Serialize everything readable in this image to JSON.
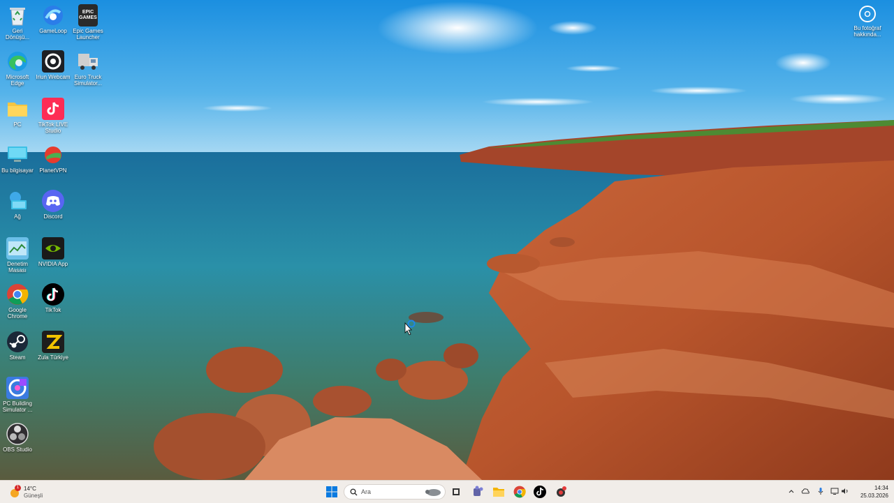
{
  "desktop": {
    "icons": [
      {
        "label": "Geri Dönüşü...",
        "icon": "recycle-bin-icon"
      },
      {
        "label": "GameLoop",
        "icon": "gameloop-icon"
      },
      {
        "label": "Epic Games Launcher",
        "icon": "epic-games-icon",
        "glyph_text": "EPIC GAMES"
      },
      {
        "label": "Microsoft Edge",
        "icon": "edge-icon"
      },
      {
        "label": "Iriun Webcam",
        "icon": "iriun-webcam-icon"
      },
      {
        "label": "Euro Truck Simulator...",
        "icon": "euro-truck-icon"
      },
      {
        "label": "PC",
        "icon": "folder-icon"
      },
      {
        "label": "TikTok LIVE Studio",
        "icon": "tiktok-live-icon"
      },
      {
        "label": "Bu bilgisayar",
        "icon": "this-pc-icon"
      },
      {
        "label": "PlanetVPN",
        "icon": "planetvpn-icon"
      },
      {
        "label": "Ağ",
        "icon": "network-icon"
      },
      {
        "label": "Discord",
        "icon": "discord-icon"
      },
      {
        "label": "Denetim Masası",
        "icon": "control-panel-icon"
      },
      {
        "label": "NVIDIA App",
        "icon": "nvidia-icon"
      },
      {
        "label": "Google Chrome",
        "icon": "chrome-icon"
      },
      {
        "label": "TikTok",
        "icon": "tiktok-icon"
      },
      {
        "label": "Steam",
        "icon": "steam-icon"
      },
      {
        "label": "Zula Türkiye",
        "icon": "zula-icon"
      },
      {
        "label": "PC Building Simulator ...",
        "icon": "pc-building-sim-icon"
      },
      {
        "label": "OBS Studio",
        "icon": "obs-icon"
      }
    ],
    "info_widget": {
      "label": "Bu fotoğraf hakkında...",
      "icon": "camera-icon"
    }
  },
  "taskbar": {
    "weather": {
      "temp": "14°C",
      "condition": "Güneşli",
      "badge": "1"
    },
    "search": {
      "placeholder": "Ara"
    },
    "clock": {
      "time": "14:34",
      "date": "25.03.2026"
    },
    "pinned": [
      "start-icon",
      "task-view-icon",
      "teams-icon",
      "file-explorer-icon",
      "chrome-icon",
      "tiktok-icon",
      "app-icon"
    ]
  },
  "colors": {
    "accent": "#0067c0",
    "taskbar_bg": "#f1ede9"
  }
}
